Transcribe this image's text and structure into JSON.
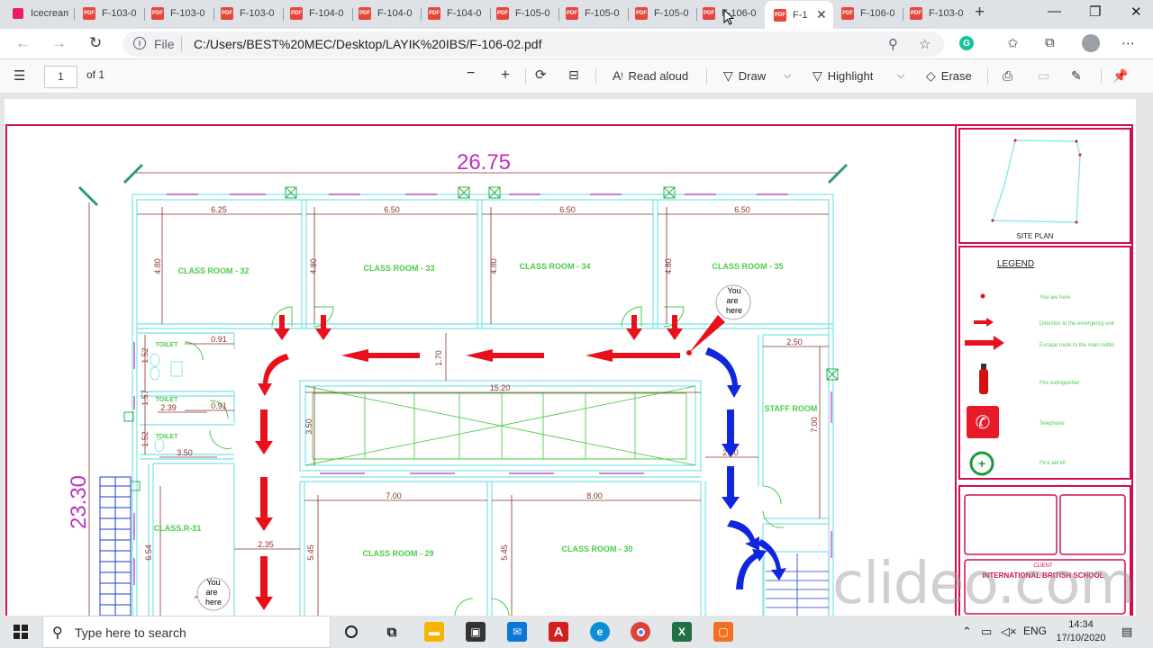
{
  "browser": {
    "tabs": [
      {
        "title": "Icecream"
      },
      {
        "title": "F-103-0"
      },
      {
        "title": "F-103-0"
      },
      {
        "title": "F-103-0"
      },
      {
        "title": "F-104-0"
      },
      {
        "title": "F-104-0"
      },
      {
        "title": "F-104-0"
      },
      {
        "title": "F-105-0"
      },
      {
        "title": "F-105-0"
      },
      {
        "title": "F-105-0"
      },
      {
        "title": "F-106-0"
      },
      {
        "title": "F-1"
      },
      {
        "title": "F-106-0"
      },
      {
        "title": "F-103-0"
      }
    ],
    "file_label": "File",
    "url": "C:/Users/BEST%20MEC/Desktop/LAYIK%20IBS/F-106-02.pdf"
  },
  "pdf_toolbar": {
    "page_number": "1",
    "page_total": "of 1",
    "read_aloud": "Read aloud",
    "draw": "Draw",
    "highlight": "Highlight",
    "erase": "Erase"
  },
  "plan": {
    "overall_width": "26.75",
    "overall_height": "23.30",
    "room_widths": [
      "6.25",
      "6.50",
      "6.50",
      "6.50"
    ],
    "room_height": "4.80",
    "rooms": {
      "class32": "CLASS ROOM - 32",
      "class33": "CLASS ROOM - 33",
      "class34": "CLASS ROOM - 34",
      "class35": "CLASS ROOM - 35",
      "staff": "STAFF ROOM",
      "class31": "CLASS.R-31",
      "class29": "CLASS ROOM - 29",
      "class30": "CLASS ROOM - 30",
      "toilet": "TOILET"
    },
    "dims": {
      "d091": "0.91",
      "d152": "1.52",
      "d157": "1.57",
      "d239": "2.39",
      "d350a": "3.50",
      "d170": "1.70",
      "d1520": "15.20",
      "d350b": "3.50",
      "d250": "2.50",
      "d700a": "7.00",
      "d200": "2.00",
      "d700b": "7.00",
      "d800": "8.00",
      "d235": "2.35",
      "d654": "6.54",
      "d545": "5.45"
    },
    "you_are_here": [
      "You",
      "are",
      "here"
    ],
    "site_plan": "SITE PLAN",
    "legend_title": "LEGEND",
    "legend_items": [
      "You are here",
      "Direction to the emergency exit",
      "Escape route to the main outlet",
      "Fire extinguisher",
      "Telephone",
      "First aid kit"
    ],
    "client_label": "CLIENT",
    "school_name": "INTERNATIONAL BRITISH SCHOOL"
  },
  "colors": {
    "wall": "#8ee6ea",
    "dimension": "#8a3030",
    "room_label": "#4ccc4c",
    "arrow_red": "#e8101a",
    "arrow_blue": "#1025e0",
    "frame": "#d0104a",
    "magenta": "#c030c0"
  },
  "taskbar": {
    "search_placeholder": "Type here to search",
    "language": "ENG",
    "time": "14:34",
    "date": "17/10/2020"
  },
  "watermark": "clideo.com"
}
